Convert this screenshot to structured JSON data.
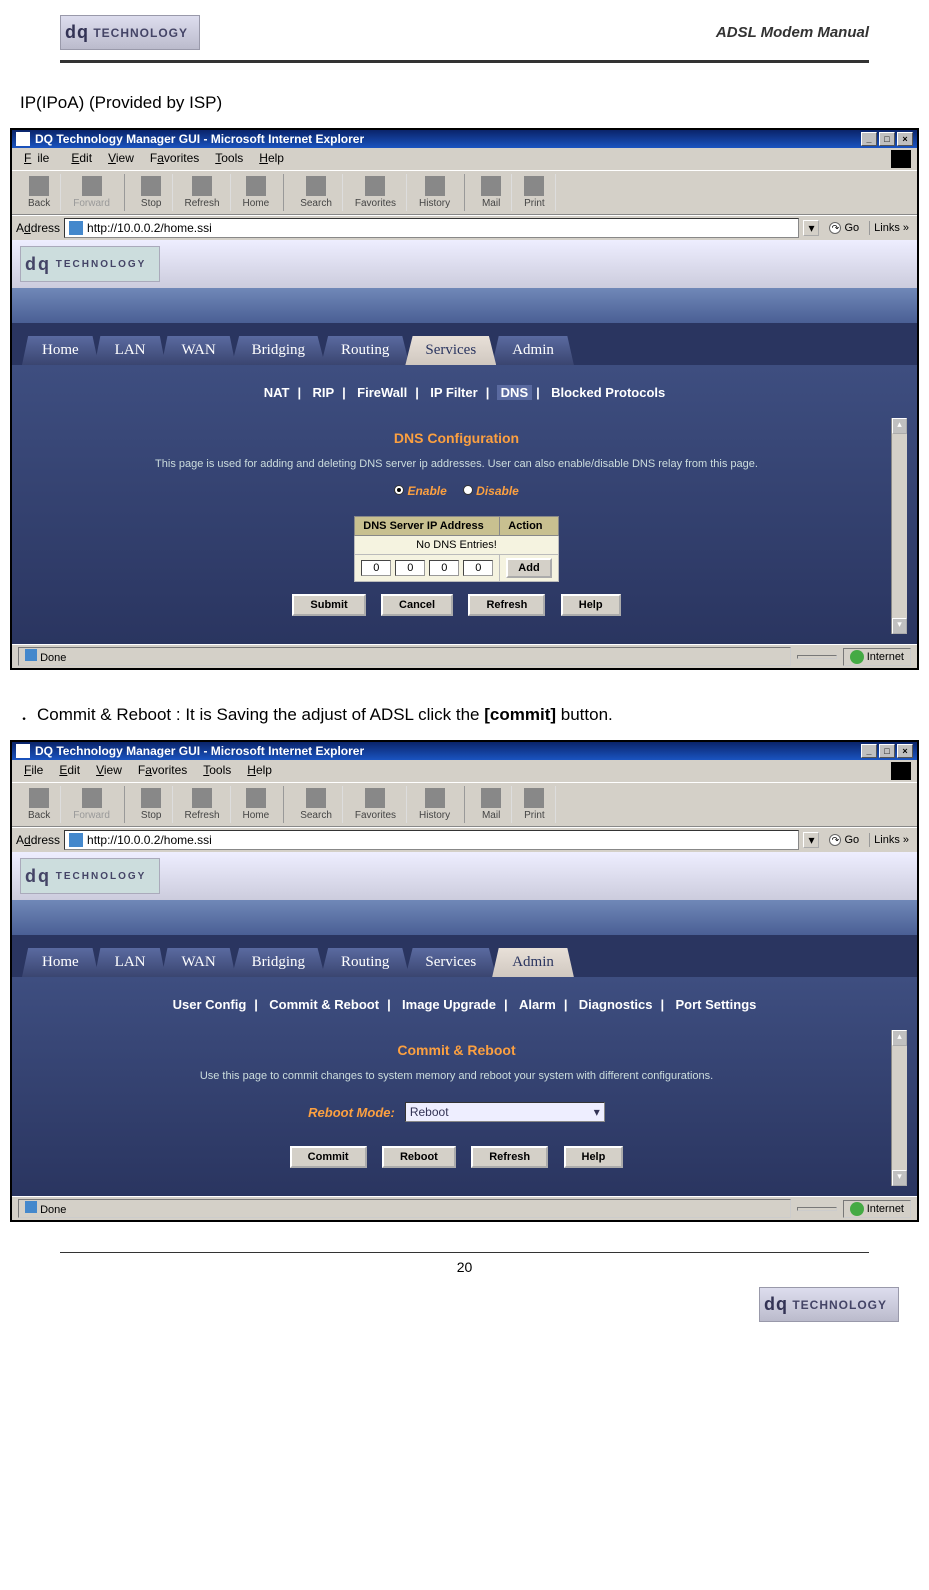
{
  "header": {
    "title": "ADSL Modem Manual",
    "logo_text": "TECHNOLOGY"
  },
  "intro": "IP(IPoA) (Provided by ISP)",
  "bullet_commit": "．Commit & Reboot : It is Saving the adjust of ADSL click the [commit] button.",
  "browser1": {
    "title": "DQ Technology Manager GUI - Microsoft Internet Explorer",
    "menu": {
      "file": "File",
      "edit": "Edit",
      "view": "View",
      "favorites": "Favorites",
      "tools": "Tools",
      "help": "Help"
    },
    "toolbar": {
      "back": "Back",
      "forward": "Forward",
      "stop": "Stop",
      "refresh": "Refresh",
      "home": "Home",
      "search": "Search",
      "favorites": "Favorites",
      "history": "History",
      "mail": "Mail",
      "print": "Print"
    },
    "address_label": "Address",
    "address_value": "http://10.0.0.2/home.ssi",
    "go": "Go",
    "links": "Links »",
    "tabs": {
      "home": "Home",
      "lan": "LAN",
      "wan": "WAN",
      "bridging": "Bridging",
      "routing": "Routing",
      "services": "Services",
      "admin": "Admin"
    },
    "submenu": {
      "nat": "NAT",
      "rip": "RIP",
      "firewall": "FireWall",
      "ipfilter": "IP Filter",
      "dns": "DNS",
      "blocked": "Blocked Protocols"
    },
    "section_title": "DNS Configuration",
    "desc": "This page is used for adding and deleting DNS server ip addresses. User can also enable/disable DNS relay from this page.",
    "enable": "Enable",
    "disable": "Disable",
    "table_h1": "DNS Server IP Address",
    "table_h2": "Action",
    "no_entries": "No DNS Entries!",
    "oct": "0",
    "add": "Add",
    "submit": "Submit",
    "cancel": "Cancel",
    "refresh_btn": "Refresh",
    "help": "Help",
    "status_done": "Done",
    "status_zone": "Internet"
  },
  "browser2": {
    "title": "DQ Technology Manager GUI - Microsoft Internet Explorer",
    "menu": {
      "file": "File",
      "edit": "Edit",
      "view": "View",
      "favorites": "Favorites",
      "tools": "Tools",
      "help": "Help"
    },
    "toolbar": {
      "back": "Back",
      "forward": "Forward",
      "stop": "Stop",
      "refresh": "Refresh",
      "home": "Home",
      "search": "Search",
      "favorites": "Favorites",
      "history": "History",
      "mail": "Mail",
      "print": "Print"
    },
    "address_label": "Address",
    "address_value": "http://10.0.0.2/home.ssi",
    "go": "Go",
    "links": "Links »",
    "tabs": {
      "home": "Home",
      "lan": "LAN",
      "wan": "WAN",
      "bridging": "Bridging",
      "routing": "Routing",
      "services": "Services",
      "admin": "Admin"
    },
    "submenu": {
      "uc": "User Config",
      "cr": "Commit & Reboot",
      "iu": "Image Upgrade",
      "al": "Alarm",
      "dg": "Diagnostics",
      "ps": "Port Settings"
    },
    "section_title": "Commit & Reboot",
    "desc": "Use this page to commit changes to system memory and reboot your system with different configurations.",
    "reboot_label": "Reboot Mode:",
    "reboot_value": "Reboot",
    "commit": "Commit",
    "reboot": "Reboot",
    "refresh_btn": "Refresh",
    "help": "Help",
    "status_done": "Done",
    "status_zone": "Internet"
  },
  "page_number": "20"
}
